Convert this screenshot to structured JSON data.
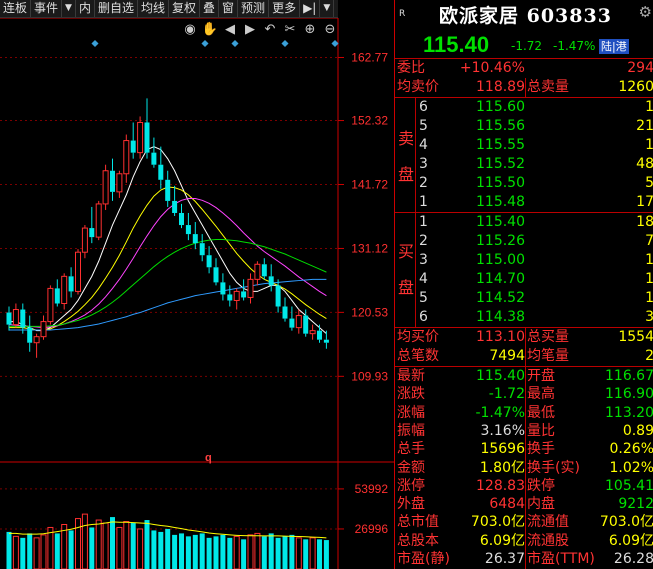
{
  "toolbar": {
    "items": [
      "连板",
      "事件",
      "内",
      "删自选",
      "均线",
      "复权",
      "叠",
      "窗",
      "预测",
      "更多",
      "▶|"
    ],
    "dropdown_marker": "▼"
  },
  "chart_data": [
    {
      "type": "candlestick",
      "title": "",
      "y_ticks": [
        162.77,
        152.32,
        141.72,
        131.12,
        120.53,
        109.93
      ],
      "ylim": [
        107.0,
        166.0
      ],
      "up_color": "#ff3030",
      "down_color": "#00e8e8",
      "candles": [
        [
          120.5,
          121.5,
          117.5,
          118.5
        ],
        [
          118.5,
          122,
          118,
          121
        ],
        [
          121,
          122,
          117,
          118
        ],
        [
          118,
          120,
          114,
          115.5
        ],
        [
          115.5,
          117,
          113,
          116.5
        ],
        [
          116.5,
          120,
          116,
          119
        ],
        [
          119,
          125,
          118.5,
          124.5
        ],
        [
          124.5,
          126,
          121.5,
          122
        ],
        [
          122,
          127,
          121,
          126.5
        ],
        [
          126.5,
          128,
          123,
          124
        ],
        [
          124,
          131,
          123.5,
          130.5
        ],
        [
          130.5,
          135,
          129.5,
          134.5
        ],
        [
          134.5,
          138,
          132,
          133
        ],
        [
          133,
          139,
          132.5,
          138.5
        ],
        [
          138.5,
          145,
          137.5,
          144
        ],
        [
          144,
          146,
          139,
          140.5
        ],
        [
          140.5,
          144,
          139.5,
          143.5
        ],
        [
          143.5,
          150,
          142,
          149
        ],
        [
          149,
          152,
          146,
          147
        ],
        [
          147,
          153,
          146,
          152
        ],
        [
          152,
          156,
          146,
          147
        ],
        [
          147,
          149.5,
          144.5,
          145
        ],
        [
          145,
          148,
          141,
          142.5
        ],
        [
          142.5,
          144,
          138,
          139
        ],
        [
          139,
          141.5,
          136.5,
          137
        ],
        [
          137,
          138.5,
          134.5,
          135
        ],
        [
          135,
          137,
          132.5,
          133.5
        ],
        [
          133.5,
          135.5,
          131,
          132
        ],
        [
          132,
          133.5,
          129,
          130
        ],
        [
          130,
          131.5,
          127,
          128
        ],
        [
          128,
          129.5,
          125,
          125.5
        ],
        [
          125.5,
          127,
          122.5,
          123.5
        ],
        [
          123.5,
          125,
          121.5,
          122.5
        ],
        [
          122.5,
          124.5,
          121,
          124
        ],
        [
          124,
          126,
          122.5,
          123
        ],
        [
          123,
          127,
          122,
          126
        ],
        [
          126,
          129,
          125,
          128.5
        ],
        [
          128.5,
          129.5,
          126,
          126.5
        ],
        [
          126.5,
          128.5,
          124,
          125
        ],
        [
          125,
          126,
          120.5,
          121.5
        ],
        [
          121.5,
          123,
          119,
          119.5
        ],
        [
          119.5,
          121.5,
          117.5,
          118
        ],
        [
          118,
          121,
          117,
          120
        ],
        [
          120,
          121,
          116.5,
          117
        ],
        [
          117,
          118.5,
          116,
          117.5
        ],
        [
          117.5,
          118.5,
          115.5,
          116
        ],
        [
          116,
          117.5,
          114.5,
          115.5
        ]
      ],
      "ma_lines": [
        {
          "color": "#ffffff",
          "points": [
            119,
            119,
            118.5,
            118,
            117.5,
            117.5,
            118,
            119,
            120,
            121,
            122.5,
            124.5,
            126.5,
            129,
            132,
            135,
            137.5,
            140,
            143,
            145.5,
            147.5,
            148,
            147.5,
            146,
            144,
            141.5,
            139,
            137,
            135,
            133,
            131,
            129,
            127,
            125.5,
            124.5,
            124,
            124,
            124.5,
            125,
            125,
            124,
            122.5,
            121,
            120,
            119,
            118,
            117
          ]
        },
        {
          "color": "#ffff00",
          "points": [
            118,
            118,
            118,
            117.8,
            117.6,
            117.6,
            117.8,
            118.3,
            119,
            119.8,
            120.7,
            121.8,
            123,
            124.5,
            126.2,
            128,
            130,
            132.2,
            134.5,
            136.5,
            138.3,
            139.8,
            140.8,
            141.3,
            141.2,
            140.8,
            140,
            138.9,
            137.6,
            136.2,
            134.8,
            133.3,
            131.8,
            130.3,
            129,
            127.8,
            126.8,
            126,
            125.5,
            125,
            124.4,
            123.6,
            122.7,
            121.8,
            121,
            120.2,
            119.5
          ]
        },
        {
          "color": "#ff44ff",
          "points": [
            118.5,
            118.4,
            118.3,
            118.2,
            118.1,
            118,
            118.1,
            118.3,
            118.6,
            119,
            119.5,
            120.1,
            120.9,
            121.9,
            123.1,
            124.5,
            126,
            127.7,
            129.5,
            131.4,
            133.2,
            134.9,
            136.4,
            137.6,
            138.5,
            139.1,
            139.4,
            139.4,
            139.1,
            138.6,
            137.9,
            137,
            136,
            134.9,
            133.7,
            132.6,
            131.5,
            130.6,
            129.8,
            129,
            128.2,
            127.3,
            126.4,
            125.6,
            124.8,
            124,
            123.3
          ]
        },
        {
          "color": "#00dd00",
          "points": [
            118.2,
            118.2,
            118.2,
            118.2,
            118.2,
            118.2,
            118.3,
            118.4,
            118.6,
            118.9,
            119.2,
            119.6,
            120.1,
            120.7,
            121.4,
            122.2,
            123.1,
            124.1,
            125.1,
            126.1,
            127.1,
            128.1,
            129,
            129.8,
            130.5,
            131.1,
            131.6,
            132,
            132.3,
            132.5,
            132.6,
            132.6,
            132.5,
            132.4,
            132.2,
            132,
            131.7,
            131.4,
            131,
            130.6,
            130.2,
            129.7,
            129.2,
            128.7,
            128.2,
            127.7,
            127.2
          ]
        },
        {
          "color": "#2f9bff",
          "points": [
            117.6,
            117.6,
            117.6,
            117.6,
            117.6,
            117.6,
            117.6,
            117.7,
            117.8,
            117.9,
            118,
            118.2,
            118.4,
            118.6,
            118.9,
            119.2,
            119.5,
            119.8,
            120.2,
            120.5,
            120.9,
            121.3,
            121.7,
            122.1,
            122.4,
            122.7,
            123,
            123.3,
            123.5,
            123.7,
            123.9,
            124.1,
            124.3,
            124.5,
            124.7,
            124.9,
            125.1,
            125.3,
            125.4,
            125.5,
            125.6,
            125.7,
            125.8,
            125.9,
            126,
            126,
            126
          ]
        }
      ]
    },
    {
      "type": "bar",
      "title": "",
      "y_ticks": [
        53992,
        26996
      ],
      "ylim": [
        0,
        60000
      ],
      "values": [
        25000,
        22000,
        21000,
        24000,
        21000,
        23000,
        28000,
        24000,
        30000,
        26000,
        34000,
        37000,
        28000,
        33000,
        31000,
        35000,
        28000,
        32000,
        31000,
        27000,
        33000,
        26000,
        25000,
        27000,
        23000,
        24000,
        22000,
        23000,
        24000,
        21000,
        22000,
        23000,
        21000,
        22000,
        20000,
        23000,
        24000,
        22000,
        24000,
        21000,
        22000,
        23000,
        21000,
        20000,
        21000,
        20000,
        19500
      ],
      "ma_points": [
        24000,
        24000,
        23500,
        23500,
        23500,
        23800,
        24500,
        25200,
        26000,
        26800,
        28000,
        29300,
        30000,
        30300,
        31000,
        31800,
        31500,
        31500,
        31300,
        31000,
        30800,
        30000,
        29300,
        28800,
        28000,
        27200,
        26300,
        25700,
        25000,
        24300,
        23800,
        23400,
        23000,
        22700,
        22500,
        22400,
        22400,
        22300,
        22300,
        22300,
        22200,
        22000,
        21900,
        21700,
        21500,
        21300,
        21000
      ],
      "ma_color": "#ffff00"
    }
  ],
  "chart_labels": {
    "price_ticks": [
      "162.77",
      "152.32",
      "141.72",
      "131.12",
      "120.53",
      "109.93"
    ],
    "vol_ticks": [
      "53992",
      "26996"
    ],
    "q_marker": "q"
  },
  "panel": {
    "r_badge": "R",
    "stock_name": "欧派家居 603833",
    "gear_icon": "⚙",
    "price": "115.40",
    "change": "-1.72",
    "change_pct": "-1.47%",
    "lugu_badge": "陆|港",
    "weibi_label": "委比",
    "weibi_value": "+10.46%",
    "weicha_value": "294",
    "junmai_label": "均卖价",
    "junmai_value": "118.89",
    "zongmai_label": "总卖量",
    "zongmai_value": "1260",
    "sell_side_label": [
      "卖",
      "盘"
    ],
    "buy_side_label": [
      "买",
      "盘"
    ],
    "sells": [
      {
        "lvl": "6",
        "price": "115.60",
        "vol": "1"
      },
      {
        "lvl": "5",
        "price": "115.56",
        "vol": "21"
      },
      {
        "lvl": "4",
        "price": "115.55",
        "vol": "1"
      },
      {
        "lvl": "3",
        "price": "115.52",
        "vol": "48"
      },
      {
        "lvl": "2",
        "price": "115.50",
        "vol": "5"
      },
      {
        "lvl": "1",
        "price": "115.48",
        "vol": "17"
      }
    ],
    "buys": [
      {
        "lvl": "1",
        "price": "115.40",
        "vol": "18"
      },
      {
        "lvl": "2",
        "price": "115.26",
        "vol": "7"
      },
      {
        "lvl": "3",
        "price": "115.00",
        "vol": "1"
      },
      {
        "lvl": "4",
        "price": "114.70",
        "vol": "1"
      },
      {
        "lvl": "5",
        "price": "114.52",
        "vol": "1"
      },
      {
        "lvl": "6",
        "price": "114.38",
        "vol": "3"
      }
    ],
    "junmai2_label": "均买价",
    "junmai2_value": "113.10",
    "zongmai2_label": "总买量",
    "zongmai2_value": "1554",
    "zongbi_label": "总笔数",
    "zongbi_value": "7494",
    "junbi_label": "均笔量",
    "junbi_value": "2",
    "stats": [
      {
        "l1": "最新",
        "v1": "115.40",
        "c1": "grn",
        "l2": "开盘",
        "v2": "116.67",
        "c2": "grn"
      },
      {
        "l1": "涨跌",
        "v1": "-1.72",
        "c1": "grn",
        "l2": "最高",
        "v2": "116.90",
        "c2": "grn"
      },
      {
        "l1": "涨幅",
        "v1": "-1.47%",
        "c1": "grn",
        "l2": "最低",
        "v2": "113.20",
        "c2": "grn"
      },
      {
        "l1": "振幅",
        "v1": "3.16%",
        "c1": "wht",
        "l2": "量比",
        "v2": "0.89",
        "c2": "yel"
      },
      {
        "l1": "总手",
        "v1": "15696",
        "c1": "yel",
        "l2": "换手",
        "v2": "0.26%",
        "c2": "yel"
      },
      {
        "l1": "金额",
        "v1": "1.80亿",
        "c1": "yel",
        "l2": "换手(实)",
        "v2": "1.02%",
        "c2": "yel"
      },
      {
        "l1": "涨停",
        "v1": "128.83",
        "c1": "red",
        "l2": "跌停",
        "v2": "105.41",
        "c2": "grn"
      },
      {
        "l1": "外盘",
        "v1": "6484",
        "c1": "red",
        "l2": "内盘",
        "v2": "9212",
        "c2": "grn"
      },
      {
        "l1": "总市值",
        "v1": "703.0亿",
        "c1": "yel",
        "l2": "流通值",
        "v2": "703.0亿",
        "c2": "yel"
      },
      {
        "l1": "总股本",
        "v1": "6.09亿",
        "c1": "yel",
        "l2": "流通股",
        "v2": "6.09亿",
        "c2": "yel"
      },
      {
        "l1": "市盈(静)",
        "v1": "26.37",
        "c1": "wht",
        "l2": "市盈(TTM)",
        "v2": "26.28",
        "c2": "wht"
      }
    ]
  }
}
